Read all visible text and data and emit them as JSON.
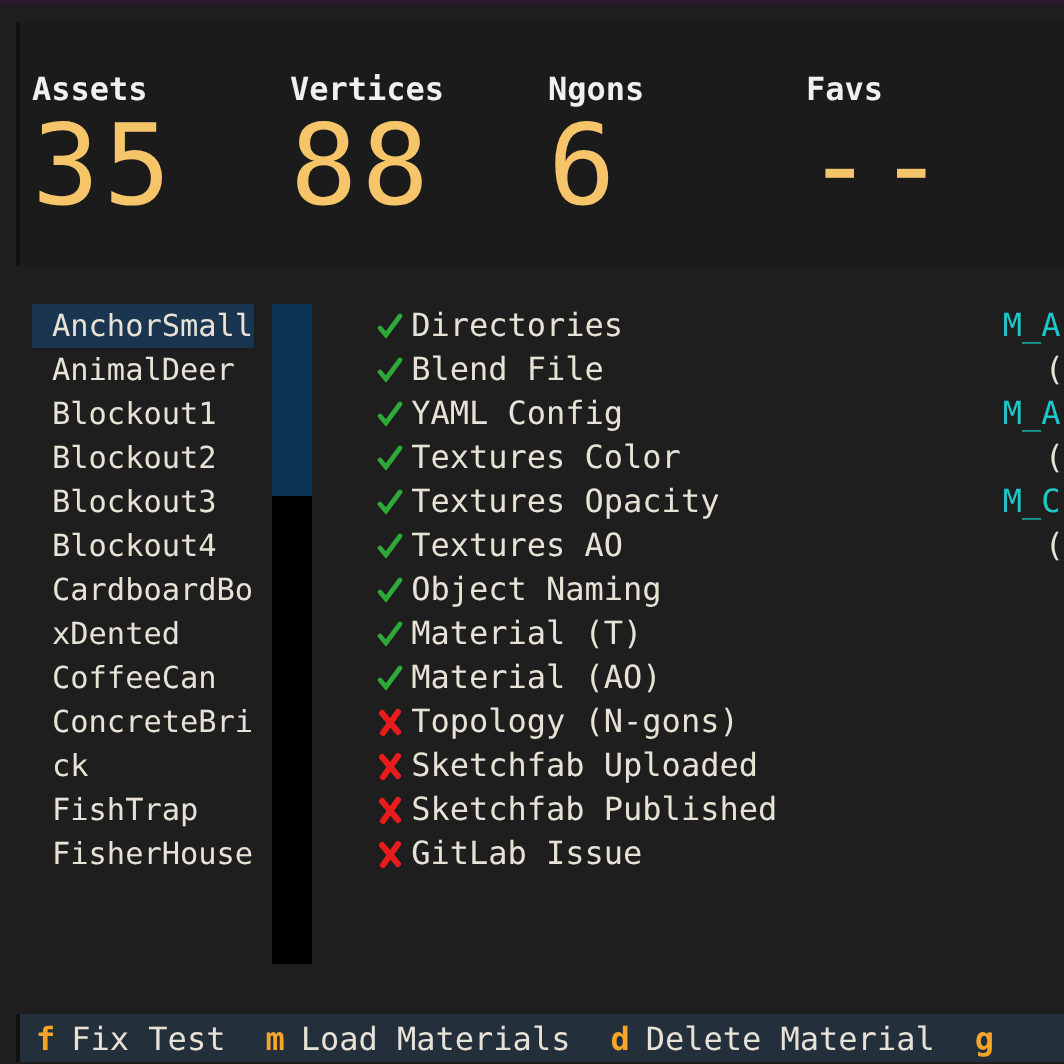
{
  "stats": [
    {
      "label": "Assets",
      "value": "35"
    },
    {
      "label": "Vertices",
      "value": "88"
    },
    {
      "label": "Ngons",
      "value": "6"
    },
    {
      "label": "Favs",
      "value": "--"
    }
  ],
  "assets": [
    {
      "name": "AnchorSmall",
      "selected": true
    },
    {
      "name": "AnimalDeer",
      "selected": false
    },
    {
      "name": "Blockout1",
      "selected": false
    },
    {
      "name": "Blockout2",
      "selected": false
    },
    {
      "name": "Blockout3",
      "selected": false
    },
    {
      "name": "Blockout4",
      "selected": false
    },
    {
      "name": "CardboardBoxDented",
      "selected": false
    },
    {
      "name": "CoffeeCan",
      "selected": false
    },
    {
      "name": "ConcreteBrick",
      "selected": false
    },
    {
      "name": "FishTrap",
      "selected": false
    },
    {
      "name": "FisherHouse",
      "selected": false
    }
  ],
  "checks": [
    {
      "label": "Directories",
      "passed": true
    },
    {
      "label": "Blend File",
      "passed": true
    },
    {
      "label": "YAML Config",
      "passed": true
    },
    {
      "label": "Textures Color",
      "passed": true
    },
    {
      "label": "Textures Opacity",
      "passed": true
    },
    {
      "label": "Textures AO",
      "passed": true
    },
    {
      "label": "Object Naming",
      "passed": true
    },
    {
      "label": "Material (T)",
      "passed": true
    },
    {
      "label": "Material (AO)",
      "passed": true
    },
    {
      "label": "Topology (N-gons)",
      "passed": false
    },
    {
      "label": "Sketchfab Uploaded",
      "passed": false
    },
    {
      "label": "Sketchfab Published",
      "passed": false
    },
    {
      "label": "GitLab Issue",
      "passed": false
    }
  ],
  "materials": [
    {
      "kind": "name",
      "text": "M_A"
    },
    {
      "kind": "detail",
      "text": "("
    },
    {
      "kind": "name",
      "text": "M_A"
    },
    {
      "kind": "detail",
      "text": "("
    },
    {
      "kind": "name",
      "text": "M_C"
    },
    {
      "kind": "detail",
      "text": "("
    }
  ],
  "shortcuts": [
    {
      "key": "f",
      "label": "Fix Test"
    },
    {
      "key": "m",
      "label": "Load Materials"
    },
    {
      "key": "d",
      "label": "Delete Material"
    },
    {
      "key": "g"
    }
  ]
}
